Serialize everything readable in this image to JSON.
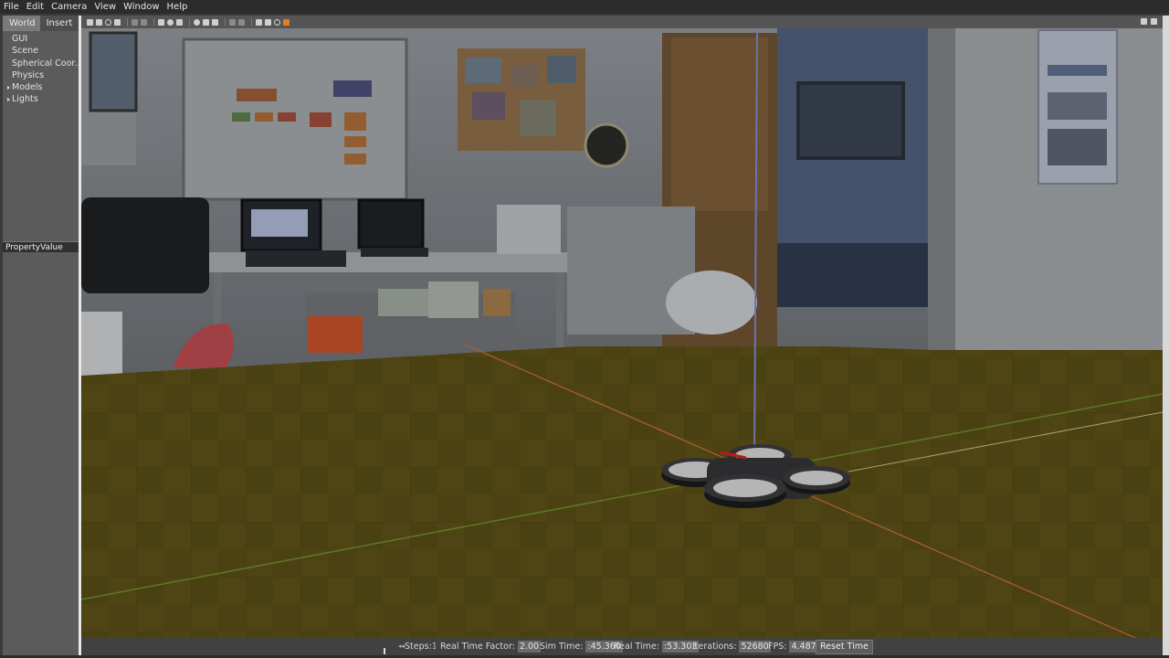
{
  "menu": [
    "File",
    "Edit",
    "Camera",
    "View",
    "Window",
    "Help"
  ],
  "tabs": {
    "world": "World",
    "insert": "Insert"
  },
  "tree": [
    {
      "label": "GUI",
      "expandable": false
    },
    {
      "label": "Scene",
      "expandable": false
    },
    {
      "label": "Spherical Coor...",
      "expandable": false
    },
    {
      "label": "Physics",
      "expandable": false
    },
    {
      "label": "Models",
      "expandable": true
    },
    {
      "label": "Lights",
      "expandable": true
    }
  ],
  "property_header": "PropertyValue",
  "toolbar_icons": [
    "select-arrow-icon",
    "translate-icon",
    "rotate-icon",
    "scale-icon",
    "undo-icon",
    "redo-icon",
    "box-icon",
    "sphere-icon",
    "cylinder-icon",
    "point-light-icon",
    "spot-light-icon",
    "directional-light-icon",
    "copy-icon",
    "paste-icon",
    "align-icon",
    "snap-icon",
    "change-view-icon",
    "screenshot-icon"
  ],
  "status": {
    "steps_label": "Steps:",
    "steps_value": "1",
    "rtf_label": "Real Time Factor:",
    "rtf_value": "2.00",
    "sim_time_label": "Sim Time:",
    "sim_time_value": ":45.360",
    "real_time_label": "Real Time:",
    "real_time_value": ":53.303",
    "iterations_label": "Iterations:",
    "iterations_value": "52680",
    "fps_label": "FPS:",
    "fps_value": "4.487",
    "reset_label": "Reset Time"
  },
  "colors": {
    "floor": "#5a4e16",
    "axis_red": "#c0392b",
    "axis_green": "#5dbb3a",
    "axis_blue": "#6a7ad8",
    "drone_body": "#2c2c2e",
    "drone_accent": "#d0201a"
  }
}
